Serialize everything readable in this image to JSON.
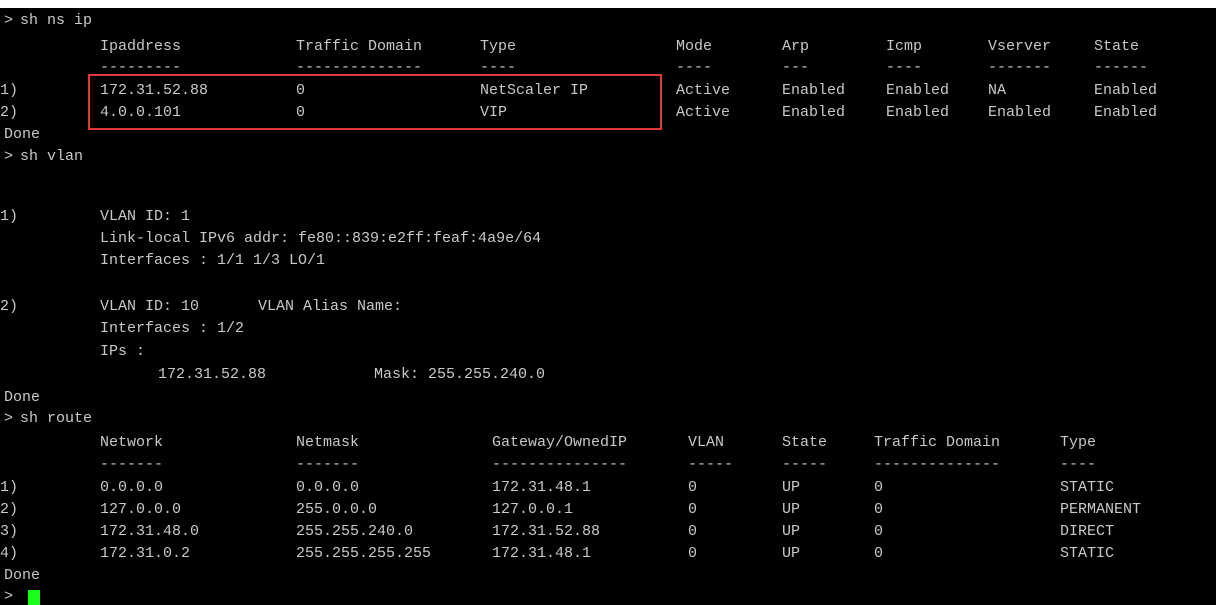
{
  "prompt": ">",
  "ip_section": {
    "command": "sh ns ip",
    "headers": [
      "Ipaddress",
      "Traffic Domain",
      "Type",
      "Mode",
      "Arp",
      "Icmp",
      "Vserver",
      "State"
    ],
    "underlines": [
      "---------",
      "--------------",
      "----",
      "----",
      "---",
      "----",
      "-------",
      "------"
    ],
    "rows": [
      {
        "idx": "1)",
        "cells": [
          "172.31.52.88",
          "0",
          "NetScaler IP",
          "Active",
          "Enabled",
          "Enabled",
          "NA",
          "Enabled"
        ]
      },
      {
        "idx": "2)",
        "cells": [
          "4.0.0.101",
          "0",
          "VIP",
          "Active",
          "Enabled",
          "Enabled",
          "Enabled",
          "Enabled"
        ]
      }
    ],
    "done": "Done"
  },
  "vlan_section": {
    "command": "sh vlan",
    "vlan1": {
      "idx": "1)",
      "id_line": "VLAN ID: 1",
      "ipv6_line": "Link-local IPv6 addr: fe80::839:e2ff:feaf:4a9e/64",
      "interfaces_line": "Interfaces : 1/1 1/3 LO/1"
    },
    "vlan2": {
      "idx": "2)",
      "id_line": "VLAN ID: 10",
      "alias_line": "VLAN Alias Name:",
      "interfaces_line": "Interfaces : 1/2",
      "ips_label": "IPs :",
      "ip": "172.31.52.88",
      "mask": "Mask: 255.255.240.0"
    },
    "done": "Done"
  },
  "route_section": {
    "command": "sh route",
    "headers": [
      "Network",
      "Netmask",
      "Gateway/OwnedIP",
      "VLAN",
      "State",
      "Traffic Domain",
      "Type"
    ],
    "underlines": [
      "-------",
      "-------",
      "---------------",
      "-----",
      "-----",
      "--------------",
      "----"
    ],
    "rows": [
      {
        "idx": "1)",
        "cells": [
          "0.0.0.0",
          "0.0.0.0",
          "172.31.48.1",
          "0",
          "UP",
          "0",
          "STATIC"
        ]
      },
      {
        "idx": "2)",
        "cells": [
          "127.0.0.0",
          "255.0.0.0",
          "127.0.0.1",
          "0",
          "UP",
          "0",
          "PERMANENT"
        ]
      },
      {
        "idx": "3)",
        "cells": [
          "172.31.48.0",
          "255.255.240.0",
          "172.31.52.88",
          "0",
          "UP",
          "0",
          "DIRECT"
        ]
      },
      {
        "idx": "4)",
        "cells": [
          "172.31.0.2",
          "255.255.255.255",
          "172.31.48.1",
          "0",
          "UP",
          "0",
          "STATIC"
        ]
      }
    ],
    "done": "Done"
  },
  "colors": {
    "background": "#000000",
    "text": "#c8c8c8",
    "highlight": "#e23a3a",
    "cursor": "#1aff1a"
  }
}
